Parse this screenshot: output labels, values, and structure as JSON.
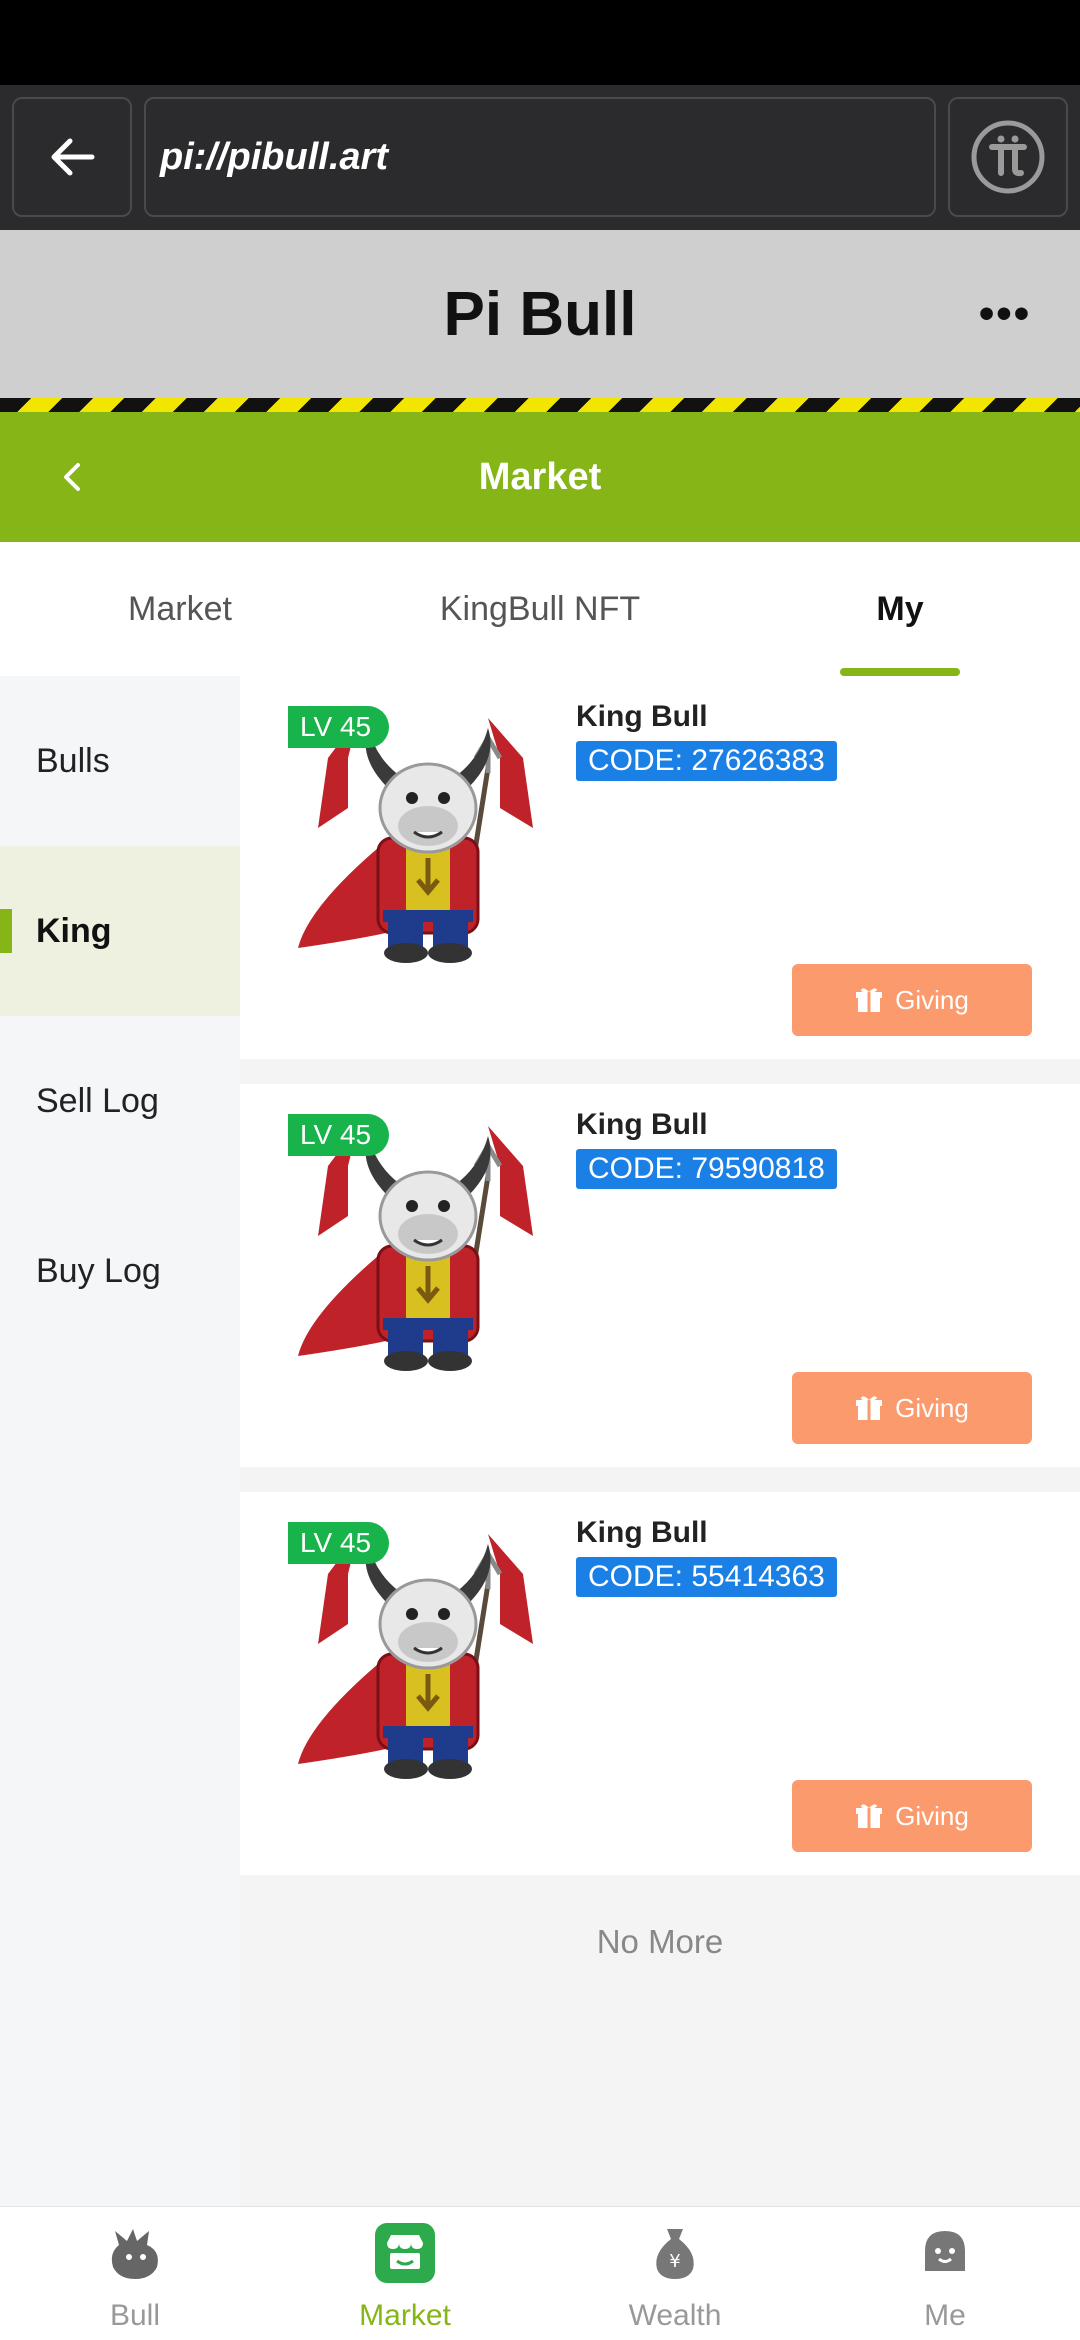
{
  "browser": {
    "url": "pi://pibull.art"
  },
  "app": {
    "title": "Pi Bull",
    "more_label": "•••"
  },
  "header": {
    "title": "Market"
  },
  "tabs": [
    {
      "label": "Market",
      "active": false
    },
    {
      "label": "KingBull NFT",
      "active": false
    },
    {
      "label": "My",
      "active": true
    }
  ],
  "sidebar": {
    "items": [
      {
        "label": "Bulls",
        "active": false
      },
      {
        "label": "King",
        "active": true
      },
      {
        "label": "Sell Log",
        "active": false
      },
      {
        "label": "Buy Log",
        "active": false
      }
    ]
  },
  "cards": [
    {
      "level": "LV 45",
      "name": "King Bull",
      "code": "CODE: 27626383",
      "action": "Giving"
    },
    {
      "level": "LV 45",
      "name": "King Bull",
      "code": "CODE: 79590818",
      "action": "Giving"
    },
    {
      "level": "LV 45",
      "name": "King Bull",
      "code": "CODE: 55414363",
      "action": "Giving"
    }
  ],
  "list_end": "No More",
  "bottom_nav": [
    {
      "label": "Bull",
      "icon": "bull-icon",
      "active": false
    },
    {
      "label": "Market",
      "icon": "market-icon",
      "active": true
    },
    {
      "label": "Wealth",
      "icon": "money-bag-icon",
      "active": false
    },
    {
      "label": "Me",
      "icon": "face-icon",
      "active": false
    }
  ],
  "colors": {
    "accent_green": "#85b517",
    "level_green": "#18b44b",
    "code_blue": "#1a80e6",
    "giving_orange": "#fb9a6c"
  }
}
